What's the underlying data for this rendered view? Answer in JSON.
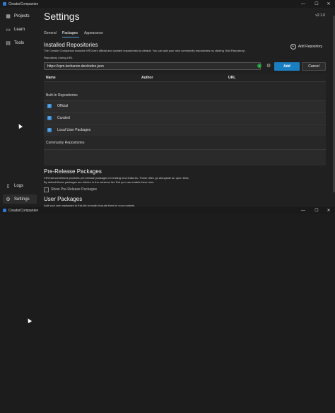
{
  "window1": {
    "title": "CreatorCompanion",
    "controls": {
      "minimize": "—",
      "maximize": "☐",
      "close": "✕"
    },
    "sidebar": {
      "items": [
        {
          "label": "Projects",
          "icon": "grid-icon"
        },
        {
          "label": "Learn",
          "icon": "book-icon"
        },
        {
          "label": "Tools",
          "icon": "briefcase-icon"
        }
      ],
      "bottom_items": [
        {
          "label": "Logs",
          "icon": "document-icon"
        },
        {
          "label": "Settings",
          "icon": "gear-icon",
          "active": true
        }
      ]
    },
    "settings": {
      "title": "Settings",
      "version": "v2.1.0",
      "tabs": [
        {
          "label": "General"
        },
        {
          "label": "Packages",
          "active": true
        },
        {
          "label": "Appearance"
        }
      ],
      "installed_repositories": {
        "title": "Installed Repositories",
        "description": "The Creator Companion includes VRChat's official and curated repositories by default. You can add your own community repositories by clicking 'Add Repository'.",
        "add_repository_label": "Add Repository",
        "listing_url_label": "Repository Listing URL",
        "listing_url_value": "https://vpm.techanon.dev/index.json",
        "add_button": "Add",
        "cancel_button": "Cancel",
        "columns": [
          "Name",
          "Author",
          "URL"
        ],
        "builtin_group": "Built-In Repositories",
        "builtin_rows": [
          {
            "label": "Official",
            "checked": true
          },
          {
            "label": "Curated",
            "checked": true
          },
          {
            "label": "Local User Packages",
            "checked": true
          }
        ],
        "community_group": "Community Repositories"
      },
      "pre_release": {
        "title": "Pre-Release Packages",
        "line1": "VRChat sometimes provides pre-release packages for testing new features. These often go alongside an open beta.",
        "line2": "By default these packages are hidden in the versions list. But you can enable them here.",
        "checkbox_label": "Show Pre-Release Packages",
        "checked": false
      },
      "user_packages": {
        "title": "User Packages",
        "line1": "Add your own packages to this list to easily include them in your projects."
      }
    }
  },
  "window2": {
    "title": "CreatorCompanion",
    "controls": {
      "minimize": "—",
      "maximize": "☐",
      "close": "✕"
    }
  },
  "colors": {
    "accent": "#1a7fc1",
    "background": "#1c1c1c",
    "panel": "#272727",
    "success": "#1f9d3a"
  }
}
